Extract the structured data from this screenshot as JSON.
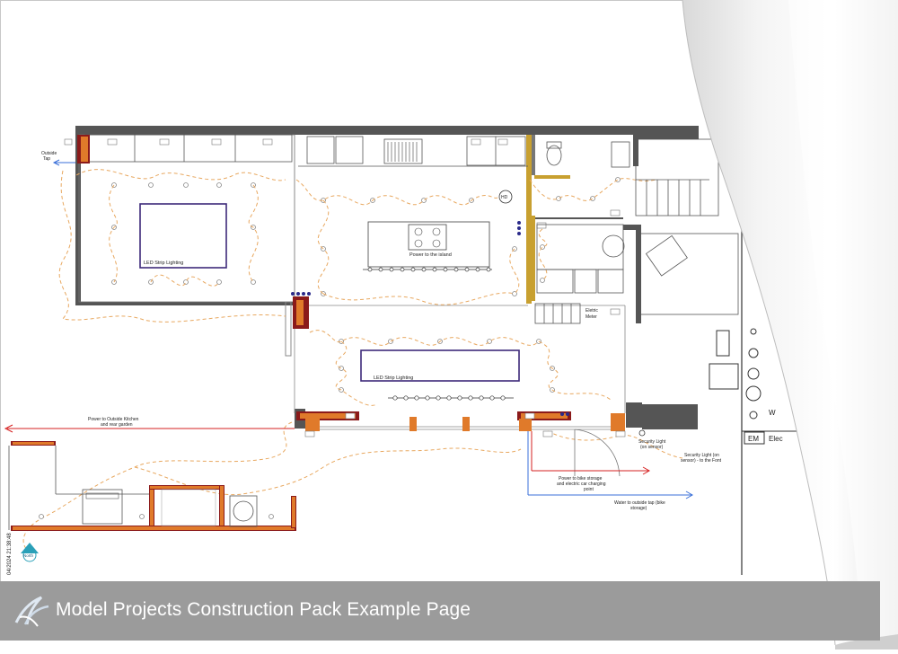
{
  "footer": {
    "title": "Model Projects Construction Pack Example Page"
  },
  "drawing": {
    "outside_tap": [
      "Outside",
      "Tap"
    ],
    "led_strip_1": "LED Strip Lighting",
    "led_strip_2": "LED Strip Lighting",
    "power_island": "Power to the island",
    "electric_meter": [
      "Eletric",
      "Meter"
    ],
    "hd": "HD",
    "power_outside_kitchen": [
      "Power to Outside Kitchen",
      "and rear garden"
    ],
    "security_light_1": [
      "Security Light",
      "(on sensor)"
    ],
    "security_light_2": [
      "Security Light (on",
      "sensor) - to the Font"
    ],
    "power_bike": [
      "Power to bike storage",
      "and electric car charging",
      "point"
    ],
    "water_tap": [
      "Water to outside tap (bike",
      "storage)"
    ],
    "date_stamp": "04/2024 21:38:48",
    "north": "North",
    "em": "EM",
    "elec": "Elec",
    "w": "W",
    "corner_m": "M"
  },
  "colors": {
    "wall": "#555555",
    "dashed_wire": "#e8a860",
    "led_box": "#3d2a7a",
    "red_line": "#d62020",
    "blue_line": "#3a6fd8",
    "footer_bg": "#9b9b9b"
  }
}
